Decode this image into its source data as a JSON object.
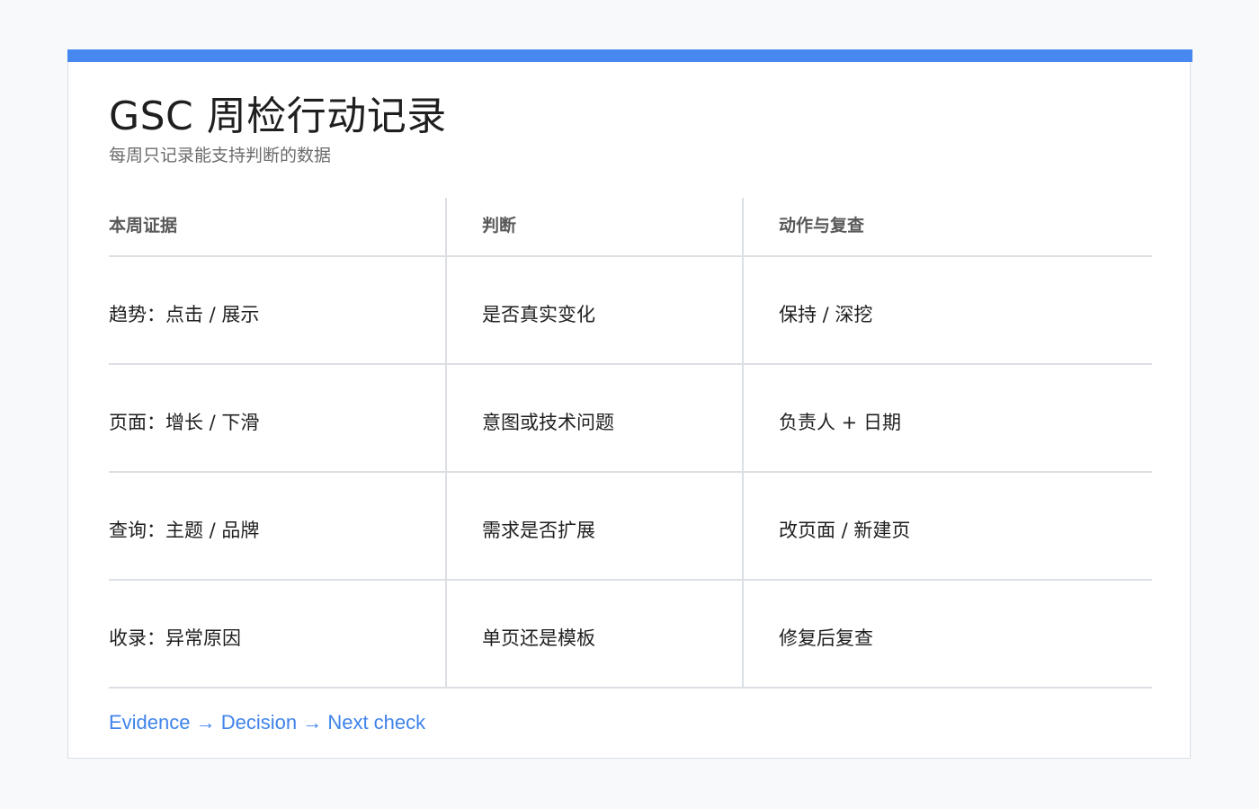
{
  "title": "GSC 周检行动记录",
  "subtitle": "每周只记录能支持判断的数据",
  "colors": {
    "accent": "#4688f0",
    "footer_link": "#3f83ea",
    "divider": "#dcdfe3"
  },
  "table": {
    "headers": [
      "本周证据",
      "判断",
      "动作与复查"
    ],
    "rows": [
      [
        "趋势：点击 / 展示",
        "是否真实变化",
        "保持 / 深挖"
      ],
      [
        "页面：增长 / 下滑",
        "意图或技术问题",
        "负责人 + 日期"
      ],
      [
        "查询：主题 / 品牌",
        "需求是否扩展",
        "改页面 / 新建页"
      ],
      [
        "收录：异常原因",
        "单页还是模板",
        "修复后复查"
      ]
    ]
  },
  "footer": "Evidence → Decision → Next check"
}
